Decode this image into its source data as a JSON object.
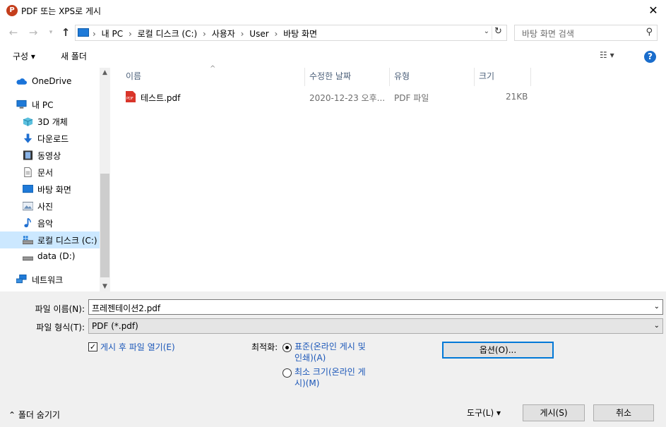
{
  "window": {
    "title": "PDF 또는 XPS로 게시",
    "app_icon": "P",
    "close_glyph": "✕"
  },
  "address": {
    "crumbs": [
      "내 PC",
      "로컬 디스크 (C:)",
      "사용자",
      "User",
      "바탕 화면"
    ],
    "search_placeholder": "바탕 화면 검색"
  },
  "toolbar": {
    "organize": "구성 ▾",
    "new_folder": "새 폴더",
    "help": "?"
  },
  "nav": {
    "items": [
      {
        "label": "OneDrive",
        "icon": "cloud-icon"
      },
      {
        "label": "내 PC",
        "icon": "computer-icon"
      },
      {
        "label": "3D 개체",
        "icon": "cube-icon"
      },
      {
        "label": "다운로드",
        "icon": "download-icon"
      },
      {
        "label": "동영상",
        "icon": "video-icon"
      },
      {
        "label": "문서",
        "icon": "document-icon"
      },
      {
        "label": "바탕 화면",
        "icon": "desktop-icon"
      },
      {
        "label": "사진",
        "icon": "picture-icon"
      },
      {
        "label": "음악",
        "icon": "music-icon"
      },
      {
        "label": "로컬 디스크 (C:)",
        "icon": "drive-icon"
      },
      {
        "label": "data (D:)",
        "icon": "drive-icon"
      },
      {
        "label": "네트워크",
        "icon": "network-icon"
      }
    ],
    "selected": "로컬 디스크 (C:)"
  },
  "filelist": {
    "columns": [
      "이름",
      "수정한 날짜",
      "유형",
      "크기"
    ],
    "rows": [
      {
        "name": "테스트.pdf",
        "modified": "2020-12-23 오후...",
        "type": "PDF 파일",
        "size": "21KB"
      }
    ]
  },
  "form": {
    "filename_label": "파일 이름(N):",
    "filename_value": "프레젠테이션2.pdf",
    "filetype_label": "파일 형식(T):",
    "filetype_value": "PDF (*.pdf)",
    "open_after_label": "게시 후 파일 열기(E)",
    "open_after_checked": true,
    "optimize_label": "최적화:",
    "optimize_standard_line1": "표준(온라인 게시 및",
    "optimize_standard_line2": "인쇄)(A)",
    "optimize_minimum_line1": "최소 크기(온라인 게",
    "optimize_minimum_line2": "시)(M)",
    "optimize_selected": "standard",
    "options_button": "옵션(O)..."
  },
  "footer": {
    "hide_folders": "폴더 숨기기",
    "tools": "도구(L)",
    "publish": "게시(S)",
    "cancel": "취소"
  }
}
